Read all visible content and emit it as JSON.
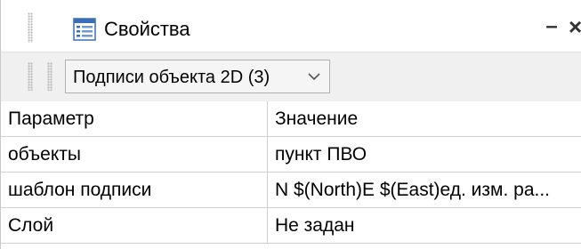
{
  "window": {
    "title": "Свойства",
    "minimize_glyph": "–",
    "close_glyph": "×",
    "title_icon": "properties-list-icon"
  },
  "toolbar": {
    "object_selector": {
      "value": "Подписи объекта 2D (3)",
      "arrow_icon": "chevron-down-icon"
    }
  },
  "grid": {
    "columns": [
      "Параметр",
      "Значение"
    ],
    "rows": [
      {
        "param": "объекты",
        "value": "пункт ПВО"
      },
      {
        "param": "шаблон подписи",
        "value": "N $(North)E $(East)ед. изм. ра..."
      },
      {
        "param": "Слой",
        "value": "Не задан"
      }
    ]
  },
  "colors": {
    "accent": "#2b6cb8",
    "grid_line": "#cfcfcf",
    "panel_bg": "#f0f0f0"
  }
}
